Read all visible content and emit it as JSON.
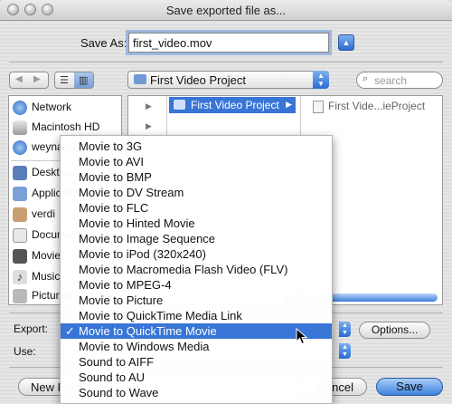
{
  "window": {
    "title": "Save exported file as..."
  },
  "save_as": {
    "label": "Save As:",
    "filename": "first_video.mov"
  },
  "toolbar": {
    "back_glyph": "◀",
    "forward_glyph": "▶",
    "location": "First Video Project",
    "search_placeholder": "search"
  },
  "sidebar": {
    "items": [
      {
        "label": "Network",
        "icon": "globe-icon"
      },
      {
        "label": "Macintosh HD",
        "icon": "hard-drive-icon"
      },
      {
        "label": "weynand",
        "icon": "user-drive-icon"
      },
      {
        "label": "Desktop",
        "icon": "desktop-icon"
      },
      {
        "label": "Applications",
        "icon": "applications-icon"
      },
      {
        "label": "verdi",
        "icon": "home-icon"
      },
      {
        "label": "Documents",
        "icon": "documents-icon"
      },
      {
        "label": "Movies",
        "icon": "movies-icon"
      },
      {
        "label": "Music",
        "icon": "music-icon"
      },
      {
        "label": "Pictures",
        "icon": "pictures-icon"
      }
    ]
  },
  "browser": {
    "selected_folder": "First Video Project",
    "file_item": "First Vide...ieProject"
  },
  "export": {
    "label": "Export:"
  },
  "use": {
    "label": "Use:"
  },
  "buttons": {
    "options": "Options...",
    "new_folder": "New Folder",
    "cancel": "Cancel",
    "save": "Save"
  },
  "export_menu": {
    "checkmark": "✓",
    "selected_index": 13,
    "items": [
      "Movie to 3G",
      "Movie to AVI",
      "Movie to BMP",
      "Movie to DV Stream",
      "Movie to FLC",
      "Movie to Hinted Movie",
      "Movie to Image Sequence",
      "Movie to iPod (320x240)",
      "Movie to Macromedia Flash Video (FLV)",
      "Movie to MPEG-4",
      "Movie to Picture",
      "Movie to QuickTime Media Link",
      "Movie to QuickTime Movie",
      "Movie to Windows Media",
      "Sound to AIFF",
      "Sound to AU",
      "Sound to Wave"
    ]
  },
  "colors": {
    "accent": "#3875d7",
    "field_focus": "#9cb9de"
  }
}
